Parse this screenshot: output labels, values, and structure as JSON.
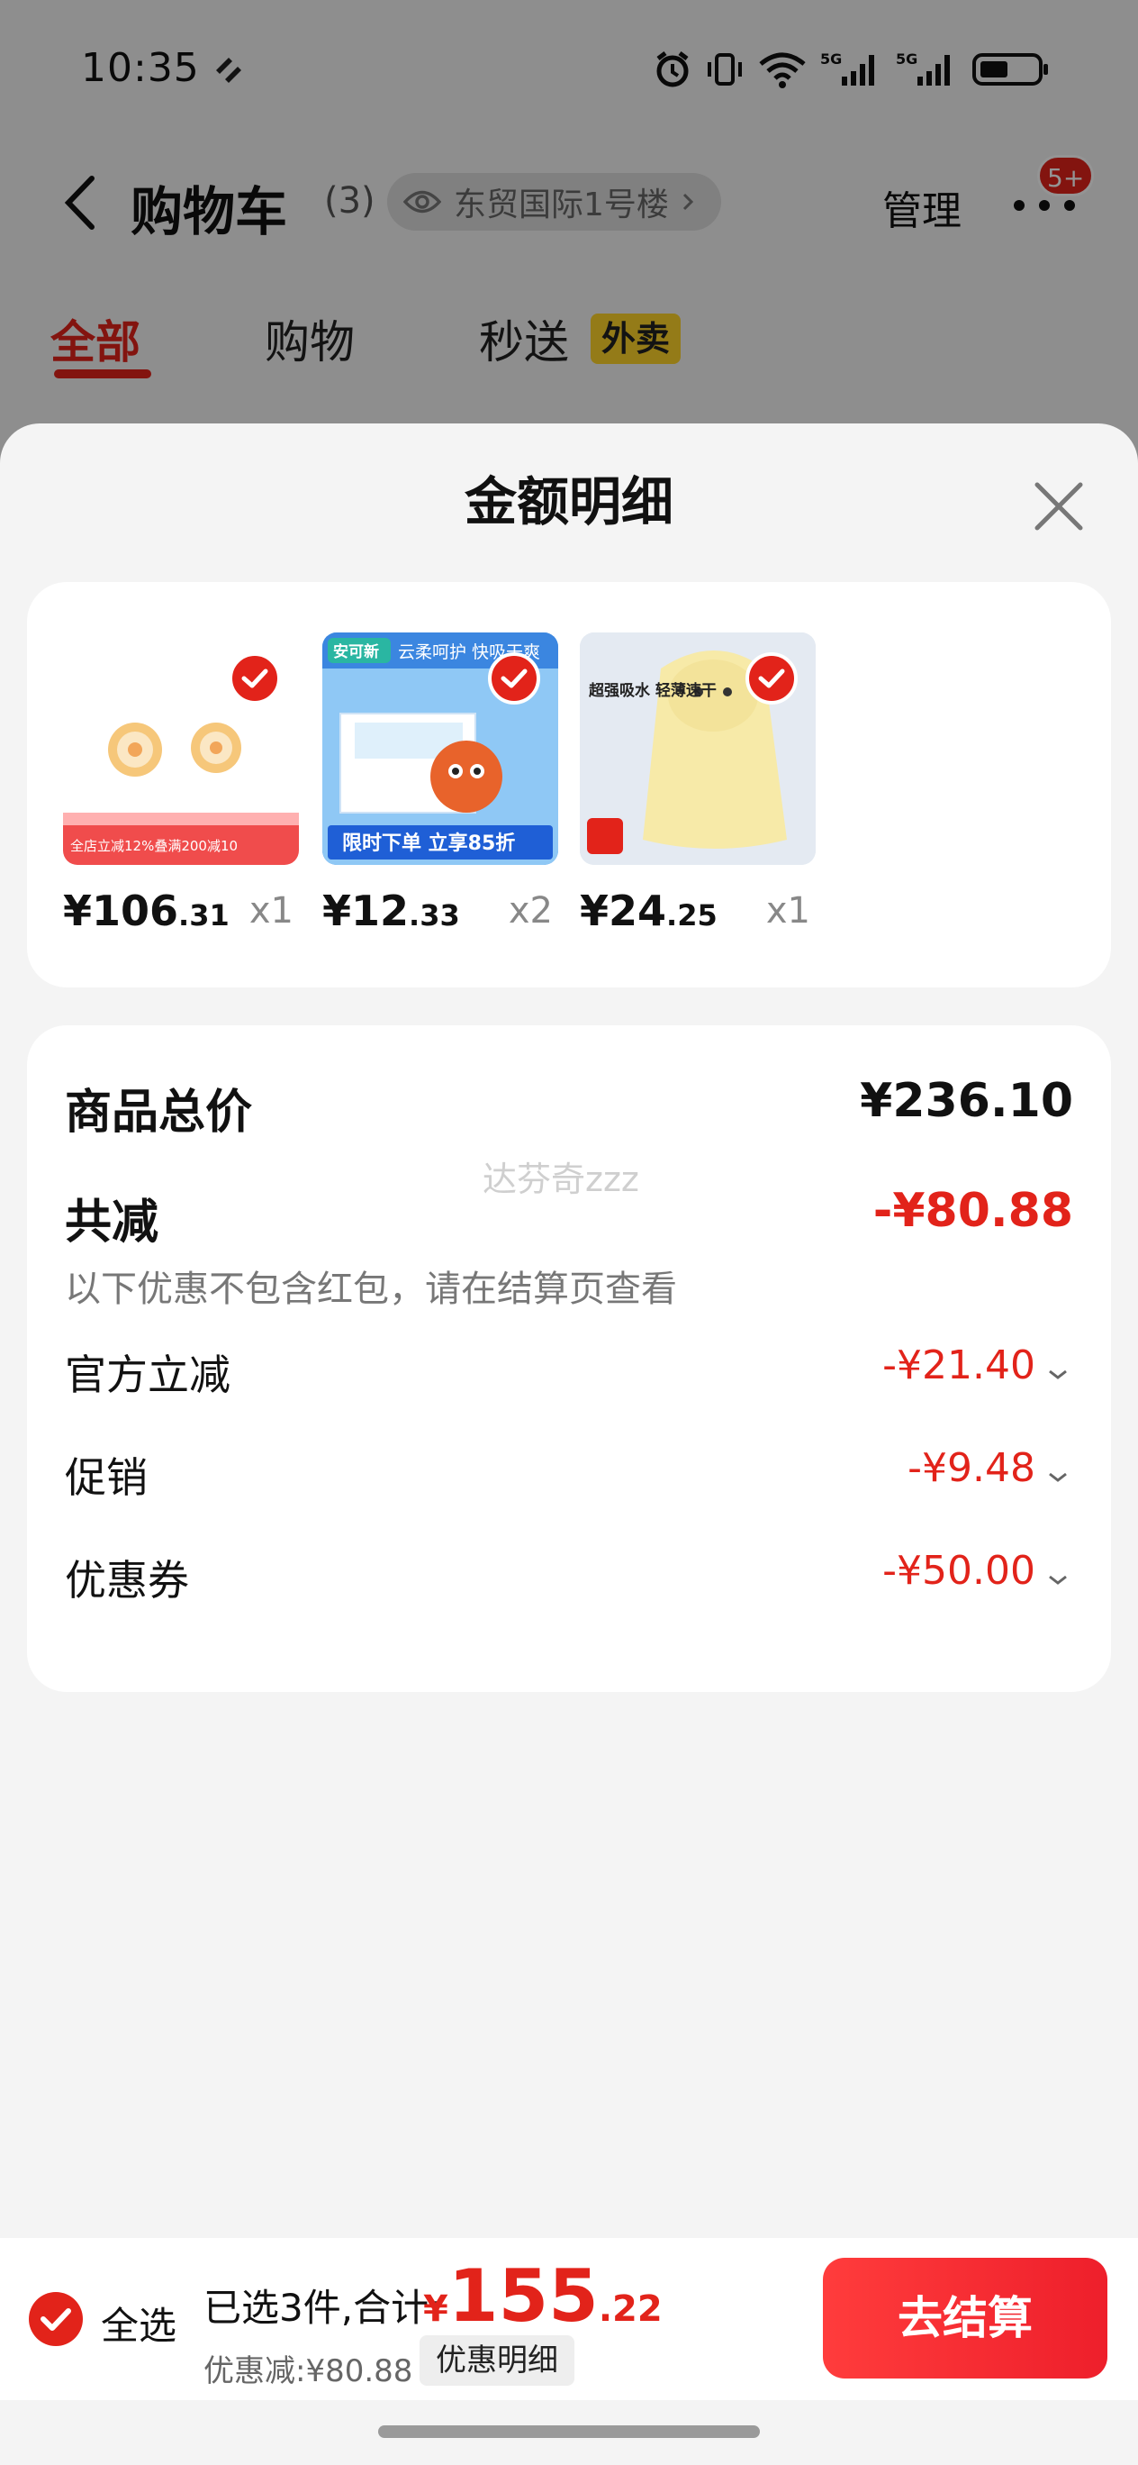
{
  "status_bar": {
    "time": "10:35"
  },
  "nav": {
    "title": "购物车",
    "count": "(3)",
    "address": "东贸国际1号楼",
    "manage": "管理",
    "badge": "5+"
  },
  "tabs": [
    {
      "label": "全部",
      "active": true
    },
    {
      "label": "购物",
      "active": false
    },
    {
      "label": "秒送",
      "active": false
    }
  ],
  "tab_tag": "外卖",
  "sheet": {
    "title": "金额明细",
    "products": [
      {
        "name": "gold-earrings",
        "price_int": "¥106",
        "price_dec": ".31",
        "qty": "x1",
        "banner_text": "全店立减12%叠满200减10"
      },
      {
        "name": "baby-diaper-pads",
        "price_int": "¥12",
        "price_dec": ".33",
        "qty": "x2",
        "top_text": "云柔呵护 快吸干爽",
        "banner_text": "限时下单 立享85折",
        "brand": "安可新"
      },
      {
        "name": "baby-hooded-towel",
        "price_int": "¥24",
        "price_dec": ".25",
        "qty": "x1",
        "top_text": "超强吸水 轻薄速干"
      }
    ],
    "summary": {
      "total_label": "商品总价",
      "total_value": "¥236.10",
      "reduce_label": "共减",
      "reduce_value": "-¥80.88",
      "note": "以下优惠不包含红包，请在结算页查看",
      "watermark": "达芬奇zzz",
      "lines": [
        {
          "label": "官方立减",
          "value": "-¥21.40"
        },
        {
          "label": "促销",
          "value": "-¥9.48"
        },
        {
          "label": "优惠券",
          "value": "-¥50.00"
        }
      ]
    }
  },
  "bottom": {
    "select_all": "全选",
    "selected_text": "已选3件,合计:",
    "total_yen": "¥",
    "total_int": "155",
    "total_dec": ".22",
    "discount_text": "优惠减:¥80.88",
    "detail_button": "优惠明细",
    "checkout": "去结算"
  },
  "colors": {
    "accent": "#e2231a",
    "tag": "#ffd42a"
  }
}
